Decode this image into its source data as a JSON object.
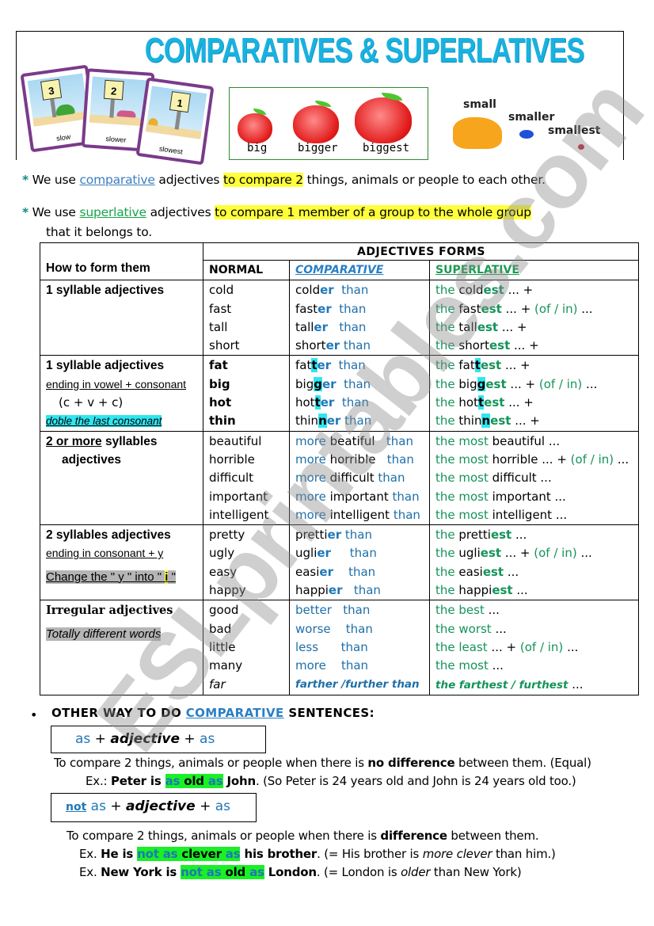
{
  "header": {
    "title": "COMPARATIVES  & SUPERLATIVES",
    "cards": [
      {
        "number": "3",
        "label": "slow",
        "animal": "turtle"
      },
      {
        "number": "2",
        "label": "slower",
        "animal": "worm"
      },
      {
        "number": "1",
        "label": "slowest",
        "animal": "snail"
      }
    ],
    "apples": [
      "big",
      "bigger",
      "biggest"
    ],
    "small_words": [
      "small",
      "smaller",
      "smallest"
    ]
  },
  "intro": {
    "line1": {
      "star": "*",
      "pre": " We use ",
      "keyword": "comparative",
      "mid": " adjectives ",
      "highlight": "to compare 2",
      "post": " things, animals or people to each other."
    },
    "line2": {
      "star": "*",
      "pre": " We use ",
      "keyword": "superlative",
      "mid": " adjectives ",
      "highlight": "to compare 1 member of a group to the whole group",
      "cont": "that it belongs to."
    }
  },
  "table": {
    "header_group": "ADJECTIVES  FORMS",
    "col_how": "How to form them",
    "col_normal": "NORMAL",
    "col_comparative": "COMPARATIVE",
    "col_superlative": "SUPERLATIVE",
    "rows": [
      {
        "rule_title": "1 syllable adjectives",
        "normal": [
          "cold",
          "fast",
          "tall",
          "short"
        ],
        "comparative": [
          {
            "base": "cold",
            "suffix": "er",
            "than": "than"
          },
          {
            "base": "fast",
            "suffix": "er",
            "than": "than"
          },
          {
            "base": "tall",
            "suffix": "er",
            "than": "than"
          },
          {
            "base": "short",
            "suffix": "er",
            "than": "than"
          }
        ],
        "superlative": [
          {
            "the": "the",
            "base": "cold",
            "suffix": "est",
            "tail": " ... +"
          },
          {
            "the": "the",
            "base": "fast",
            "suffix": "est",
            "tail": " ... + ",
            "ofin": "(of / in)",
            "end": " ..."
          },
          {
            "the": "the",
            "base": "tall",
            "suffix": "est",
            "tail": " ... +"
          },
          {
            "the": "the",
            "base": "short",
            "suffix": "est",
            "tail": " ... +"
          }
        ]
      },
      {
        "rule_title": "1 syllable adjectives",
        "rule_sub": "ending in vowel + consonant",
        "rule_formula": "(c + v + c)",
        "rule_note": "doble the last consonant",
        "normal": [
          "fat",
          "big",
          "hot",
          "thin"
        ],
        "comparative": [
          {
            "base": "fat",
            "double": "t",
            "suffix": "er",
            "than": "than"
          },
          {
            "base": "big",
            "double": "g",
            "suffix": "er",
            "than": "than"
          },
          {
            "base": "hot",
            "double": "t",
            "suffix": "er",
            "than": "than"
          },
          {
            "base": "thin",
            "double": "n",
            "suffix": "er",
            "than": "than"
          }
        ],
        "superlative": [
          {
            "the": "the",
            "base": "fat",
            "double": "t",
            "suffix": "est",
            "tail": " ... +"
          },
          {
            "the": "the",
            "base": "big",
            "double": "g",
            "suffix": "est",
            "tail": " ... + ",
            "ofin": "(of / in)",
            "end": " ..."
          },
          {
            "the": "the",
            "base": "hot",
            "double": "t",
            "suffix": "est",
            "tail": " ... +"
          },
          {
            "the": "the",
            "base": "thin",
            "double": "n",
            "suffix": "est",
            "tail": " ... +"
          }
        ]
      },
      {
        "rule_title_underlined": "2 or more",
        "rule_title_rest": " syllables",
        "rule_title_line2": "adjectives",
        "normal": [
          "beautiful",
          "horrible",
          "difficult",
          "important",
          "intelligent"
        ],
        "comparative": [
          {
            "more": "more",
            "word": " beatiful",
            "than": "than"
          },
          {
            "more": "more",
            "word": " horrible",
            "than": "than"
          },
          {
            "more": "more",
            "word": " difficult",
            "than": "than"
          },
          {
            "more": "more",
            "word": " important",
            "than": "than"
          },
          {
            "more": "more",
            "word": " intelligent",
            "than": "than"
          }
        ],
        "superlative": [
          {
            "most": "the most",
            "word": " beautiful ..."
          },
          {
            "most": "the most",
            "word": " horrible ... + ",
            "ofin": "(of / in)",
            "end": " ..."
          },
          {
            "most": "the most",
            "word": " difficult ..."
          },
          {
            "most": "the most",
            "word": " important ..."
          },
          {
            "most": "the most",
            "word": " intelligent ..."
          }
        ]
      },
      {
        "rule_title": "2 syllables adjectives",
        "rule_sub": "ending in consonant + y",
        "rule_note_pre": "Change the \" y \" into \" ",
        "rule_note_i": "i",
        "rule_note_post": " \"",
        "normal": [
          "pretty",
          "ugly",
          "easy",
          "happy"
        ],
        "comparative": [
          {
            "base": "pretti",
            "suffix": "er",
            "than": "than"
          },
          {
            "base": "ugli",
            "suffix": "er",
            "than": "than"
          },
          {
            "base": "easi",
            "suffix": "er",
            "than": "than"
          },
          {
            "base": "happi",
            "suffix": "er",
            "than": "than"
          }
        ],
        "superlative": [
          {
            "the": "the",
            "base": "pretti",
            "suffix": "est",
            "tail": " ..."
          },
          {
            "the": "the",
            "base": "ugli",
            "suffix": "est",
            "tail": " ... + ",
            "ofin": "(of / in)",
            "end": " ..."
          },
          {
            "the": "the",
            "base": "easi",
            "suffix": "est",
            "tail": " ..."
          },
          {
            "the": "the",
            "base": "happi",
            "suffix": "est",
            "tail": " ..."
          }
        ]
      },
      {
        "rule_title": "Irregular  adjectives",
        "rule_note": "Totally different words",
        "normal": [
          "good",
          "bad",
          "little",
          "many",
          "far"
        ],
        "comparative": [
          {
            "word": "better",
            "than": "than"
          },
          {
            "word": "worse",
            "than": "than"
          },
          {
            "word": "less",
            "than": "than"
          },
          {
            "word": "more",
            "than": "than"
          },
          {
            "word": "farther /further than"
          }
        ],
        "superlative": [
          {
            "word": "the best",
            "tail": " ..."
          },
          {
            "word": "the worst",
            "tail": " ..."
          },
          {
            "word": "the least",
            "tail": " ... + ",
            "ofin": "(of / in)",
            "end": " ..."
          },
          {
            "word": "the most",
            "tail": " ..."
          },
          {
            "word": "the farthest / furthest",
            "tail": " ..."
          }
        ]
      }
    ]
  },
  "other": {
    "bullet": "•",
    "title_pre": "OTHER WAY TO DO ",
    "title_keyword": "COMPARATIVE",
    "title_post": " SENTENCES:",
    "formula1": {
      "as1": "as",
      "plus1": " + ",
      "adj": "adjective",
      "plus2": " + ",
      "as2": "as"
    },
    "desc1_pre": "To compare 2 things, animals or people when there is ",
    "desc1_bold": "no difference",
    "desc1_post": " between them. (Equal)",
    "ex1": {
      "label": "Ex.: ",
      "subj": "Peter is ",
      "as1": "as",
      "adj": " old ",
      "as2": "as",
      "obj": " John",
      "rest": ".   (So Peter is 24 years old and John is 24 years old too.)"
    },
    "formula2": {
      "not": "not",
      "as1": " as",
      "plus1": " + ",
      "adj": "adjective",
      "plus2": " + ",
      "as2": "as"
    },
    "desc2_pre": "To compare 2 things, animals or people when there is ",
    "desc2_bold": "difference",
    "desc2_post": " between them.",
    "ex2": {
      "label": "Ex.  ",
      "subj": "He is ",
      "not": "not",
      "as1": " as",
      "adj": " clever ",
      "as2": "as",
      "obj": " his brother",
      "rest_pre": ".   (= His brother is ",
      "rest_it": "more clever",
      "rest_post": " than him.)"
    },
    "ex3": {
      "label": "Ex.  ",
      "subj": "New York is ",
      "not": "not",
      "as1": " as",
      "adj": " old ",
      "as2": "as",
      "obj": " London",
      "rest_pre": ".    (= London is ",
      "rest_it": "older",
      "rest_post": " than New York)"
    }
  },
  "watermark": "ESLprintables.com"
}
